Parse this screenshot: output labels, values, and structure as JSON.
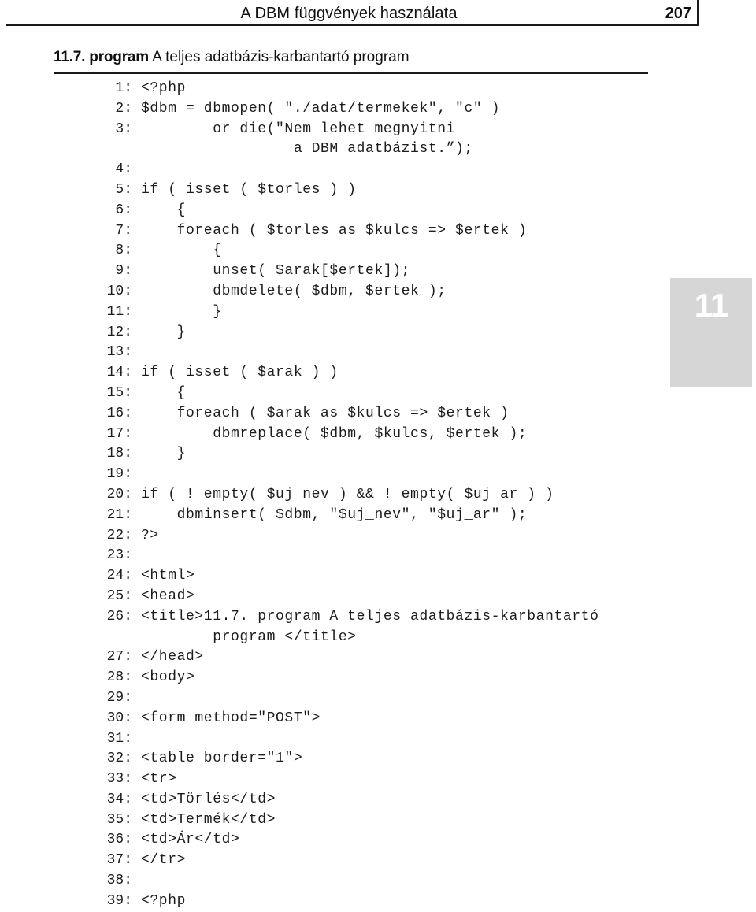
{
  "page": {
    "running_head": "A DBM függvények használata",
    "folio": "207",
    "chapter_thumb": "11"
  },
  "caption": {
    "number": "11.7. program",
    "title": " A teljes adatbázis-karbantartó program"
  },
  "listing": {
    "lines": [
      {
        "n": "1:",
        "text": "<?php"
      },
      {
        "n": "2:",
        "text": "$dbm = dbmopen( \"./adat/termekek\", \"c\" )"
      },
      {
        "n": "3:",
        "text": "        or die(\"Nem lehet megnyitni"
      },
      {
        "n": "",
        "text": "                 a DBM adatbázist.”);",
        "continuation": true
      },
      {
        "n": "4:",
        "text": ""
      },
      {
        "n": "5:",
        "text": "if ( isset ( $torles ) )"
      },
      {
        "n": "6:",
        "text": "    {"
      },
      {
        "n": "7:",
        "text": "    foreach ( $torles as $kulcs => $ertek )"
      },
      {
        "n": "8:",
        "text": "        {"
      },
      {
        "n": "9:",
        "text": "        unset( $arak[$ertek]);"
      },
      {
        "n": "10:",
        "text": "        dbmdelete( $dbm, $ertek );"
      },
      {
        "n": "11:",
        "text": "        }"
      },
      {
        "n": "12:",
        "text": "    }"
      },
      {
        "n": "13:",
        "text": ""
      },
      {
        "n": "14:",
        "text": "if ( isset ( $arak ) )"
      },
      {
        "n": "15:",
        "text": "    {"
      },
      {
        "n": "16:",
        "text": "    foreach ( $arak as $kulcs => $ertek )"
      },
      {
        "n": "17:",
        "text": "        dbmreplace( $dbm, $kulcs, $ertek );"
      },
      {
        "n": "18:",
        "text": "    }"
      },
      {
        "n": "19:",
        "text": ""
      },
      {
        "n": "20:",
        "text": "if ( ! empty( $uj_nev ) && ! empty( $uj_ar ) )"
      },
      {
        "n": "21:",
        "text": "    dbminsert( $dbm, \"$uj_nev\", \"$uj_ar\" );"
      },
      {
        "n": "22:",
        "text": "?>"
      },
      {
        "n": "23:",
        "text": ""
      },
      {
        "n": "24:",
        "text": "<html>"
      },
      {
        "n": "25:",
        "text": "<head>"
      },
      {
        "n": "26:",
        "text": "<title>11.7. program A teljes adatbázis-karbantartó"
      },
      {
        "n": "",
        "text": "        program </title>",
        "continuation": true
      },
      {
        "n": "27:",
        "text": "</head>"
      },
      {
        "n": "28:",
        "text": "<body>"
      },
      {
        "n": "29:",
        "text": ""
      },
      {
        "n": "30:",
        "text": "<form method=\"POST\">"
      },
      {
        "n": "31:",
        "text": ""
      },
      {
        "n": "32:",
        "text": "<table border=\"1\">"
      },
      {
        "n": "33:",
        "text": "<tr>"
      },
      {
        "n": "34:",
        "text": "<td>Törlés</td>"
      },
      {
        "n": "35:",
        "text": "<td>Termék</td>"
      },
      {
        "n": "36:",
        "text": "<td>Ár</td>"
      },
      {
        "n": "37:",
        "text": "</tr>"
      },
      {
        "n": "38:",
        "text": ""
      },
      {
        "n": "39:",
        "text": "<?php"
      }
    ]
  }
}
